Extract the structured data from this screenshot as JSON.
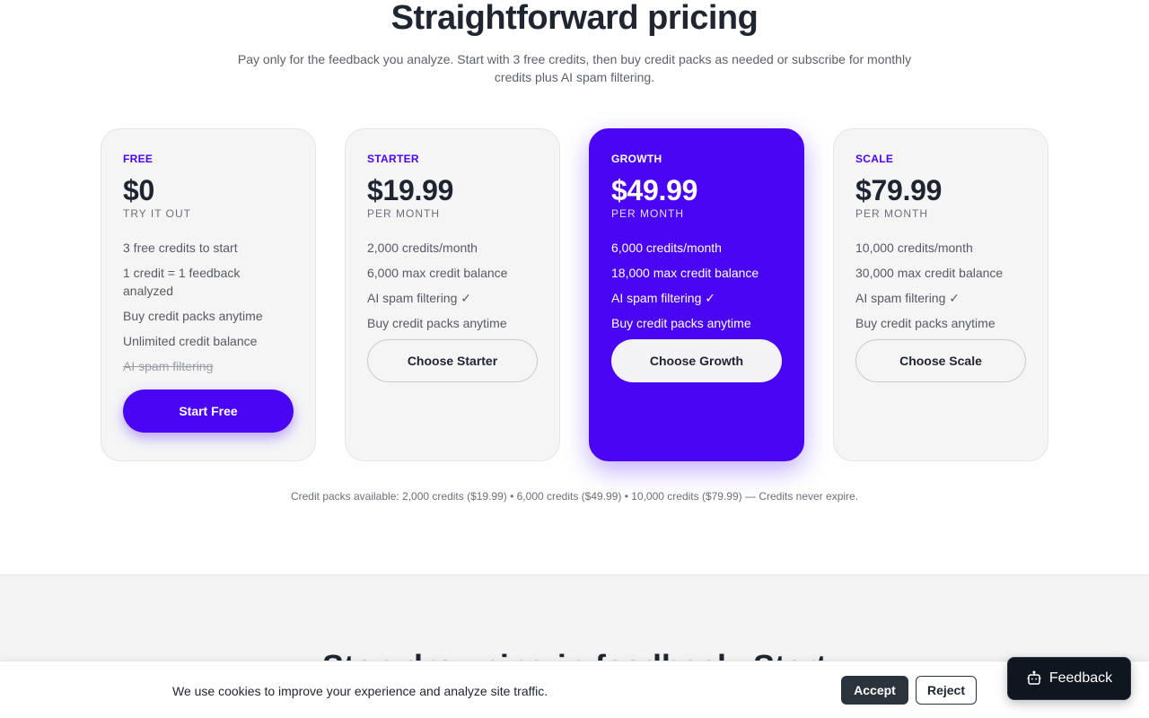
{
  "pricing": {
    "heading": "Straightforward pricing",
    "subtitle": "Pay only for the feedback you analyze. Start with 3 free credits, then buy credit packs as needed or subscribe for monthly credits plus AI spam filtering.",
    "plans": [
      {
        "tier": "FREE",
        "price": "$0",
        "period": "TRY IT OUT",
        "features": [
          "3 free credits to start",
          "1 credit = 1 feedback analyzed",
          "Buy credit packs anytime",
          "Unlimited credit balance",
          "AI spam filtering"
        ],
        "button": "Start Free"
      },
      {
        "tier": "STARTER",
        "price": "$19.99",
        "period": "PER MONTH",
        "features": [
          "2,000 credits/month",
          "6,000 max credit balance",
          "AI spam filtering ✓",
          "Buy credit packs anytime"
        ],
        "button": "Choose Starter"
      },
      {
        "tier": "GROWTH",
        "price": "$49.99",
        "period": "PER MONTH",
        "features": [
          "6,000 credits/month",
          "18,000 max credit balance",
          "AI spam filtering ✓",
          "Buy credit packs anytime"
        ],
        "button": "Choose Growth"
      },
      {
        "tier": "SCALE",
        "price": "$79.99",
        "period": "PER MONTH",
        "features": [
          "10,000 credits/month",
          "30,000 max credit balance",
          "AI spam filtering ✓",
          "Buy credit packs anytime"
        ],
        "button": "Choose Scale"
      }
    ],
    "packs_note": "Credit packs available: 2,000 credits ($19.99) • 6,000 credits ($49.99) • 10,000 credits ($79.99) — Credits never expire."
  },
  "next_section": {
    "heading": "Stop drowning in feedback. Start"
  },
  "cookie": {
    "text": "We use cookies to improve your experience and analyze site traffic.",
    "accept": "Accept",
    "reject": "Reject"
  },
  "feedback_widget": {
    "label": "Feedback",
    "icon": "robot-icon"
  },
  "colors": {
    "accent": "#4a05f5",
    "dark": "#1e2530"
  }
}
